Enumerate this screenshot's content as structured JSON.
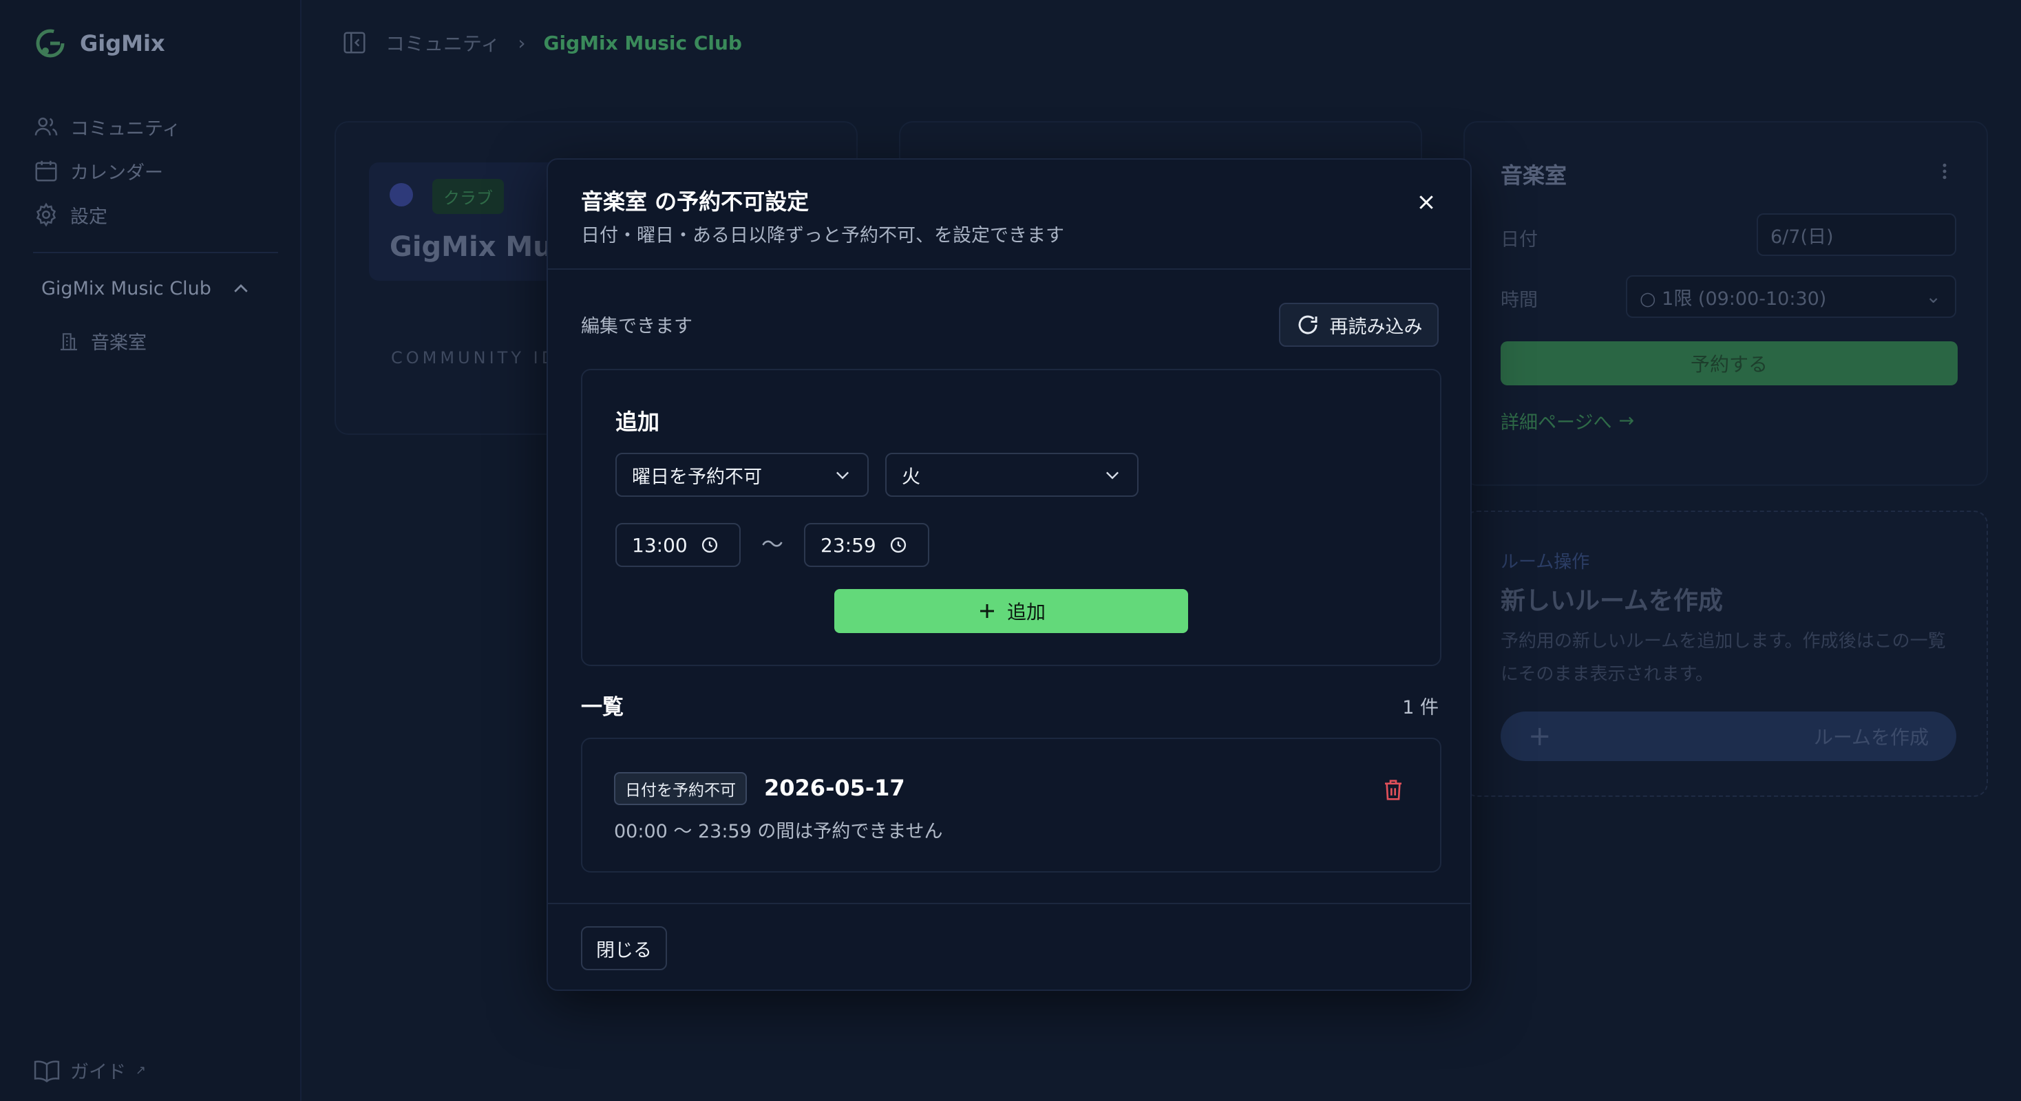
{
  "app": {
    "name": "GigMix"
  },
  "sidebar": {
    "nav": [
      {
        "label": "コミュニティ",
        "icon": "users-icon"
      },
      {
        "label": "カレンダー",
        "icon": "calendar-icon"
      },
      {
        "label": "設定",
        "icon": "gear-icon"
      }
    ],
    "club": {
      "name": "GigMix Music Club"
    },
    "rooms": [
      {
        "label": "音楽室",
        "icon": "building-icon"
      }
    ],
    "guide_label": "ガイド"
  },
  "breadcrumb": {
    "parent": "コミュニティ",
    "current": "GigMix Music Club"
  },
  "background": {
    "club_card": {
      "tag": "クラブ",
      "title": "GigMix Musi",
      "community_id_label": "COMMUNITY ID"
    },
    "room_card": {
      "title": "音楽室",
      "date_label": "日付",
      "date_value": "6/7(日)",
      "time_label": "時間",
      "time_value": "1限 (09:00-10:30)",
      "reserve_button": "予約する",
      "detail_link": "詳細ページへ"
    },
    "create_card": {
      "eyebrow": "ルーム操作",
      "title": "新しいルームを作成",
      "description": "予約用の新しいルームを追加します。作成後はこの一覧にそのまま表示されます。",
      "button": "ルームを作成"
    }
  },
  "modal": {
    "title": "音楽室 の予約不可設定",
    "subtitle": "日付・曜日・ある日以降ずっと予約不可、を設定できます",
    "editable_label": "編集できます",
    "reload_button": "再読み込み",
    "add_section": {
      "heading": "追加",
      "type_select": "曜日を予約不可",
      "weekday_select": "火",
      "start_time": "13:00",
      "range_separator": "〜",
      "end_time": "23:59",
      "add_button": "追加"
    },
    "list": {
      "heading": "一覧",
      "count": "1 件",
      "items": [
        {
          "badge": "日付を予約不可",
          "date": "2026-05-17",
          "description": "00:00 〜 23:59 の間は予約できません"
        }
      ]
    },
    "close_button": "閉じる"
  },
  "colors": {
    "accent": "#63d97a",
    "danger": "#e0505a",
    "modal_bg": "#0e1729",
    "page_bg": "#101a2c"
  }
}
